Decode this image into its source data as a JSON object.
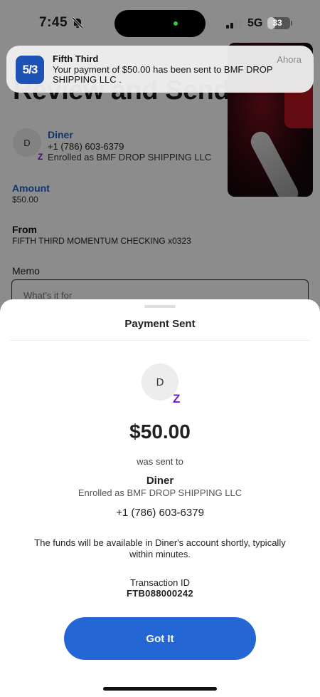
{
  "status_bar": {
    "time": "7:45",
    "network": "5G",
    "battery": "33",
    "battery_level": 0.33
  },
  "notification": {
    "app_icon_text": "5/3",
    "app_name": "Fifth Third",
    "time": "Ahora",
    "message": "Your payment of $50.00 has been sent to BMF DROP SHIPPING LLC ."
  },
  "background": {
    "title": "Review and Send",
    "recipient_initial": "D",
    "recipient_name": "Diner",
    "recipient_phone": "+1 (786) 603-6379",
    "zelle_glyph": "Z",
    "enrolled": "Enrolled as BMF DROP SHIPPING LLC",
    "amount_label": "Amount",
    "amount_value": "$50.00",
    "from_label": "From",
    "from_value": "FIFTH THIRD MOMENTUM CHECKING x0323",
    "memo_label": "Memo",
    "memo_placeholder": "What's it for"
  },
  "sheet": {
    "title": "Payment Sent",
    "avatar_initial": "D",
    "zelle_glyph": "Z",
    "amount": "$50.00",
    "sent_to": "was sent to",
    "recipient_name": "Diner",
    "enrolled": "Enrolled as BMF DROP SHIPPING LLC",
    "phone": "+1 (786) 603-6379",
    "funds_note": "The funds will be available in Diner's account shortly, typically within minutes.",
    "transaction_label": "Transaction ID",
    "transaction_id": "FTB088000242",
    "button_label": "Got It"
  },
  "colors": {
    "brand_blue": "#2466d3",
    "zelle_purple": "#6d1ed4",
    "link_blue": "#1f5fc6"
  }
}
